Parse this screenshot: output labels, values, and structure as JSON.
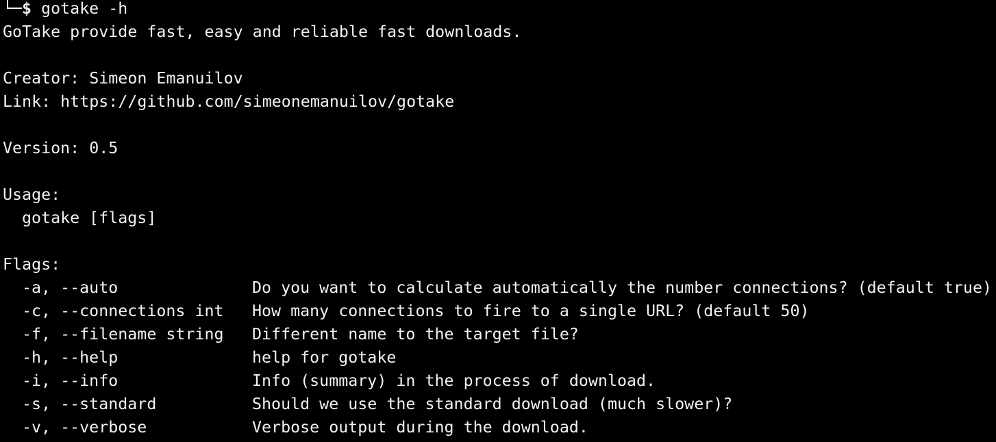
{
  "prompt": {
    "symbol": "$",
    "command": " gotake -h"
  },
  "output": {
    "description": "GoTake provide fast, easy and reliable fast downloads.",
    "creator": "Creator: Simeon Emanuilov",
    "link": "Link: https://github.com/simeonemanuilov/gotake",
    "version": "Version: 0.5",
    "usage_heading": "Usage:",
    "usage_line": "gotake [flags]",
    "flags_heading": "Flags:",
    "flags": [
      {
        "name": "-a, --auto",
        "desc": "Do you want to calculate automatically the number connections? (default true)"
      },
      {
        "name": "-c, --connections int",
        "desc": "How many connections to fire to a single URL? (default 50)"
      },
      {
        "name": "-f, --filename string",
        "desc": "Different name to the target file?"
      },
      {
        "name": "-h, --help",
        "desc": "help for gotake"
      },
      {
        "name": "-i, --info",
        "desc": "Info (summary) in the process of download."
      },
      {
        "name": "-s, --standard",
        "desc": "Should we use the standard download (much slower)?"
      },
      {
        "name": "-v, --verbose",
        "desc": "Verbose output during the download."
      }
    ]
  },
  "colors": {
    "background": "#000000",
    "foreground": "#f2f2f2"
  }
}
